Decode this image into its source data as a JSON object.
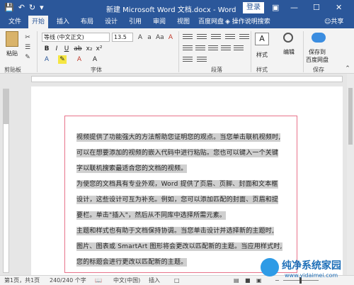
{
  "titlebar": {
    "title": "新建 Microsoft Word 文档.docx  -  Word",
    "login": "登录",
    "save_icon": "save-icon",
    "undo_icon": "undo-icon",
    "redo_icon": "redo-icon",
    "customize_icon": "customize-icon"
  },
  "tabs": {
    "file": "文件",
    "home": "开始",
    "insert": "插入",
    "layout": "布局",
    "design": "设计",
    "references": "引用",
    "mailings": "审阅",
    "view": "视图",
    "baidu": "百度网盘",
    "tellme": "操作说明搜索",
    "share": "共享"
  },
  "ribbon": {
    "paste": "粘贴",
    "clipboard": "剪贴板",
    "font_name": "等线 (中文正文)",
    "font_size": "13.5",
    "font_group": "字体",
    "paragraph_group": "段落",
    "styles": "样式",
    "styles_group": "样式",
    "edit": "编辑",
    "save_baidu": "保存到",
    "save_baidu2": "百度网盘",
    "save_group": "保存",
    "bold": "B",
    "italic": "I",
    "underline": "U"
  },
  "document": {
    "lines": [
      "视频提供了功能强大的方法帮助您证明您的观点。当您单击联机视频时,",
      "可以在想要添加的视频的嵌入代码中进行粘贴。您也可以键入一个关键",
      "字以联机搜索最适合您的文档的视频。",
      "为使您的文档具有专业外观，Word 提供了页眉、页脚、封面和文本框",
      "设计，这些设计可互为补充。例如，您可以添加匹配的封面、页眉和提",
      "要栏。单击\"插入\"，然后从不同库中选择所需元素。",
      "主题和样式也有助于文档保持协调。当您单击设计并选择新的主题时,",
      "图片、图表或 SmartArt 图形将会更改以匹配新的主题。当应用样式时,",
      "您的标题会进行更改以匹配新的主题。"
    ]
  },
  "status": {
    "page": "第1页，共1页",
    "words": "240/240 个字",
    "lang": "中文(中国)",
    "mode": "插入"
  },
  "watermark": {
    "name": "纯净系统家园",
    "url": "www.yidaimei.com"
  }
}
